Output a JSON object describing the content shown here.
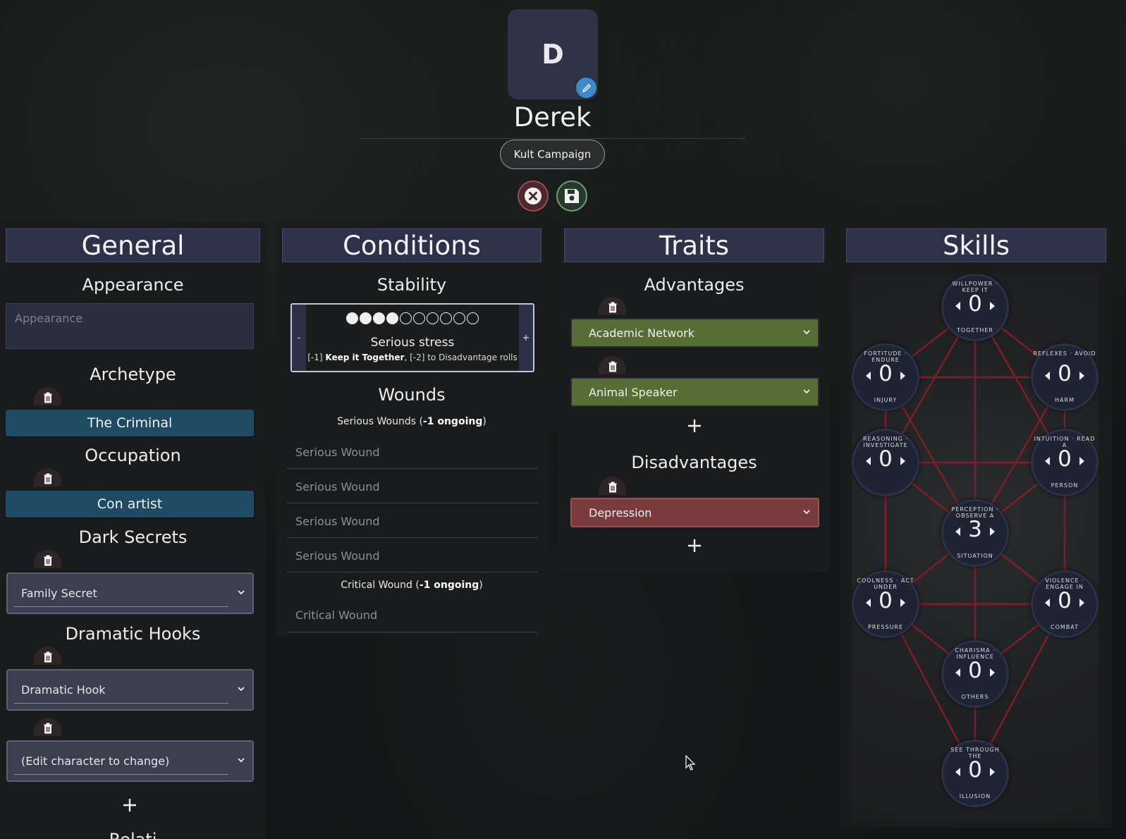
{
  "header": {
    "avatar_letter": "D",
    "character_name": "Derek",
    "campaign": "Kult Campaign"
  },
  "general": {
    "title": "General",
    "appearance_heading": "Appearance",
    "appearance_placeholder": "Appearance",
    "archetype_heading": "Archetype",
    "archetype_value": "The Criminal",
    "occupation_heading": "Occupation",
    "occupation_value": "Con artist",
    "dark_secrets_heading": "Dark Secrets",
    "dark_secret_value": "Family Secret",
    "dramatic_hooks_heading": "Dramatic Hooks",
    "dramatic_hooks": [
      "Dramatic Hook",
      "(Edit character to change)"
    ],
    "next_heading_partial": "Relati"
  },
  "conditions": {
    "title": "Conditions",
    "stability_heading": "Stability",
    "stability_filled": 4,
    "stability_total": 10,
    "stability_minus": "-",
    "stability_plus": "+",
    "stability_state": "Serious stress",
    "stability_desc_pre": "[-1] ",
    "stability_desc_bold": "Keep it Together",
    "stability_desc_post": ", [-2] to Disadvantage rolls",
    "wounds_heading": "Wounds",
    "serious_label": "Serious Wounds (",
    "serious_ongoing": "-1 ongoing",
    "serious_close": ")",
    "serious_wounds": [
      "Serious Wound",
      "Serious Wound",
      "Serious Wound",
      "Serious Wound"
    ],
    "critical_label": "Critical Wound (",
    "critical_ongoing": "-1 ongoing",
    "critical_close": ")",
    "critical_wound": "Critical Wound"
  },
  "traits": {
    "title": "Traits",
    "advantages_heading": "Advantages",
    "advantages": [
      "Academic Network",
      "Animal Speaker"
    ],
    "disadvantages_heading": "Disadvantages",
    "disadvantages": [
      "Depression"
    ]
  },
  "skills": {
    "title": "Skills",
    "items": [
      {
        "top": "Willpower · Keep it",
        "bottom": "Together",
        "value": "0"
      },
      {
        "top": "Fortitude · Endure",
        "bottom": "Injury",
        "value": "0"
      },
      {
        "top": "Reflexes · Avoid",
        "bottom": "Harm",
        "value": "0"
      },
      {
        "top": "Reasoning · Investigate",
        "bottom": "",
        "value": "0"
      },
      {
        "top": "Intuition · Read a",
        "bottom": "Person",
        "value": "0"
      },
      {
        "top": "Perception · Observe a",
        "bottom": "Situation",
        "value": "3"
      },
      {
        "top": "Coolness · Act under",
        "bottom": "Pressure",
        "value": "0"
      },
      {
        "top": "Violence · Engage in",
        "bottom": "Combat",
        "value": "0"
      },
      {
        "top": "Charisma · Influence",
        "bottom": "Others",
        "value": "0"
      },
      {
        "top": "See through the",
        "bottom": "Illusion",
        "value": "0"
      }
    ]
  },
  "colors": {
    "panel_title_bg": "#2d3149",
    "archetype_chip": "#1f4a63",
    "advantage": "#566d36",
    "disadvantage": "#7a3b3d",
    "skill_lines": "#8a1c2a"
  }
}
